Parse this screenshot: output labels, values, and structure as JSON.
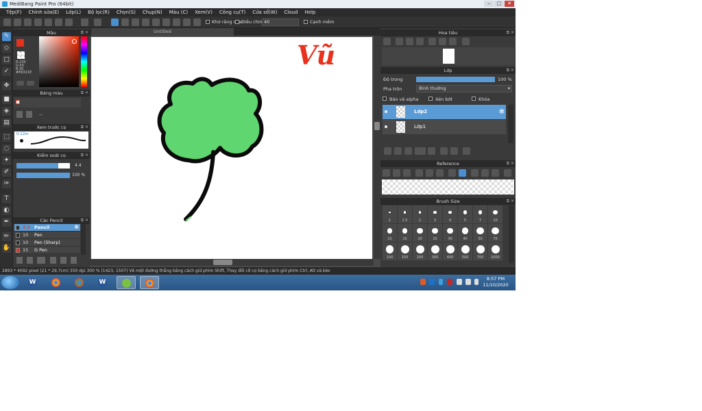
{
  "window": {
    "title": "MediBang Paint Pro (64bit)",
    "minimize": "‒",
    "maximize": "□",
    "close": "✕"
  },
  "menu": [
    "Tệp(F)",
    "Chỉnh sửa(E)",
    "Lớp(L)",
    "Bộ lọc(R)",
    "Chọn(S)",
    "Chụp(N)",
    "Màu (C)",
    "Xem(V)",
    "Công cụ(T)",
    "Cửa sổ(W)",
    "Cloud",
    "Help"
  ],
  "toolbar": {
    "antialias_label": "Khử răng cưa",
    "correction_label": "Điều chỉnh",
    "correction_value": "40",
    "snap_label": "Cạnh mềm"
  },
  "color_panel": {
    "title": "Màu",
    "main_color": "#e8321e",
    "rgb_r": "R:230",
    "rgb_g": "G:50",
    "rgb_b": "B:30",
    "hex": "#E6321E"
  },
  "palette_panel": {
    "title": "Bảng màu",
    "more": "..."
  },
  "brush_preview_panel": {
    "title": "Xem trước cọ",
    "size_label": "0.12m"
  },
  "brush_control_panel": {
    "title": "Kiểm soát cọ",
    "size_value": "4.4",
    "opacity_value": "100 %",
    "size_fraction": 0.78,
    "opacity_fraction": 1.0
  },
  "brush_list_panel": {
    "title": "Các Pencil",
    "items": [
      {
        "size": "4.4",
        "name": "Pencil",
        "color": "#2a2a2a",
        "selected": true
      },
      {
        "size": "10",
        "name": "Pen",
        "color": "#2a2a2a",
        "selected": false
      },
      {
        "size": "10",
        "name": "Pen (Sharp)",
        "color": "#2a2a2a",
        "selected": false
      },
      {
        "size": "15",
        "name": "G Pen",
        "color": "#e8321e",
        "selected": false
      }
    ]
  },
  "document": {
    "tab_title": "Untitled",
    "drawing_text": "Vũ"
  },
  "navigator_panel": {
    "title": "Hoa tiêu"
  },
  "layer_panel": {
    "title": "Lớp",
    "opacity_label": "Độ trong",
    "opacity_value": "100 %",
    "opacity_fraction": 1.0,
    "blend_label": "Pha trộn",
    "blend_value": "Bình thường",
    "protect_alpha": "Bảo vệ alpha",
    "clipping": "Xén bớt",
    "lock": "Khóa",
    "layers": [
      {
        "name": "Lớp2",
        "selected": true
      },
      {
        "name": "Lớp1",
        "selected": false
      }
    ]
  },
  "reference_panel": {
    "title": "Reference"
  },
  "brush_size_panel": {
    "title": "Brush Size",
    "sizes": [
      "1",
      "1.5",
      "2",
      "3",
      "4",
      "5",
      "7",
      "10",
      "15",
      "15",
      "20",
      "25",
      "30",
      "40",
      "50",
      "70",
      "100",
      "150",
      "200",
      "300",
      "400",
      "500",
      "700",
      "1000"
    ]
  },
  "statusbar": {
    "text": "2893 * 4092 pixel   (21 * 29.7cm)   350 dpi   300 %   (1423, 1507)   Vẽ một đường thẳng bằng cách giữ phím Shift, Thay đổi cỡ cọ bằng cách giữ phím Ctrl, Alt và kéo"
  },
  "taskbar": {
    "time": "8:57 PM",
    "date": "11/10/2020",
    "apps": [
      "windows-explorer",
      "word-2013",
      "chrome",
      "chrome",
      "word",
      "medibang",
      "chrome"
    ]
  }
}
